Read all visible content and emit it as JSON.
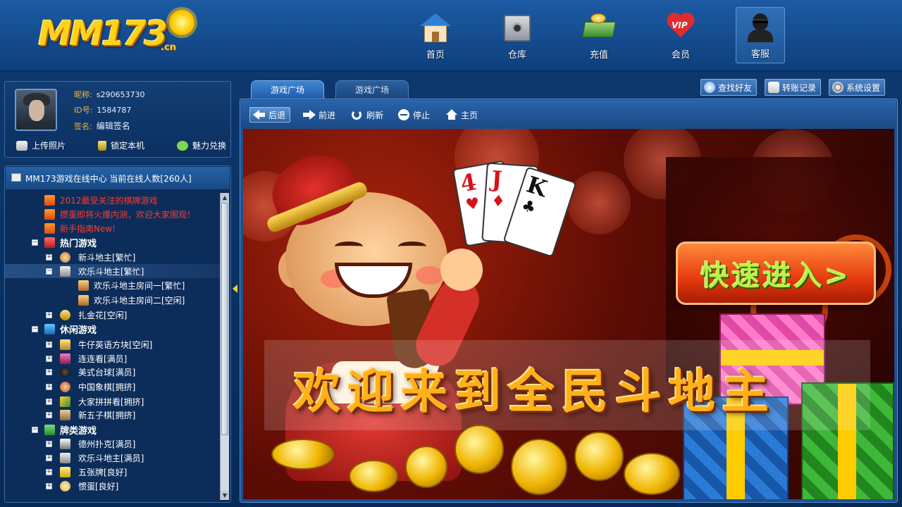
{
  "app": {
    "logo_text": "MM173",
    "logo_sub": ".cn"
  },
  "topnav": [
    {
      "label": "首页",
      "icon": "home-icon"
    },
    {
      "label": "仓库",
      "icon": "safe-icon"
    },
    {
      "label": "充值",
      "icon": "money-icon"
    },
    {
      "label": "会员",
      "icon": "vip-heart-icon",
      "badge": "VIP"
    },
    {
      "label": "客服",
      "icon": "customer-service-icon"
    }
  ],
  "profile": {
    "nick_key": "昵称:",
    "nick": "s290653730",
    "id_key": "ID号:",
    "id": "1584787",
    "sign_key": "签名:",
    "sign": "编辑签名",
    "actions": {
      "upload_photo": "上传照片",
      "lock_machine": "锁定本机",
      "charm_exchange": "魅力兑换"
    }
  },
  "gamelist": {
    "title": "MM173游戏在线中心 当前在线人数[260人]",
    "notices": [
      "2012最受关注的棋牌游戏",
      "掼蛋即将火爆内测，欢迎大家围观！",
      "新手指南New!"
    ],
    "categories": [
      {
        "name": "热门游戏",
        "items": [
          {
            "label": "新斗地主[繁忙]"
          },
          {
            "label": "欢乐斗地主[繁忙]",
            "rooms": [
              "欢乐斗地主房间一[繁忙]",
              "欢乐斗地主房间二[空闲]"
            ]
          },
          {
            "label": "扎金花[空闲]"
          }
        ]
      },
      {
        "name": "休闲游戏",
        "items": [
          {
            "label": "牛仔英语方块[空闲]"
          },
          {
            "label": "连连看[满员]"
          },
          {
            "label": "美式台球[满员]"
          },
          {
            "label": "中国象棋[拥挤]"
          },
          {
            "label": "大家拼拼看[拥挤]"
          },
          {
            "label": "新五子棋[拥挤]"
          }
        ]
      },
      {
        "name": "牌类游戏",
        "items": [
          {
            "label": "德州扑克[满员]"
          },
          {
            "label": "欢乐斗地主[满员]"
          },
          {
            "label": "五张牌[良好]"
          },
          {
            "label": "惯蛋[良好]"
          }
        ]
      }
    ]
  },
  "tabs": [
    "游戏广场",
    "游戏广场"
  ],
  "top_buttons": {
    "find_friend": "查找好友",
    "transfer_record": "转账记录",
    "system_settings": "系统设置"
  },
  "browser_toolbar": {
    "back": "后退",
    "forward": "前进",
    "refresh": "刷新",
    "stop": "停止",
    "home": "主页"
  },
  "banner": {
    "card_values": [
      "4",
      "J",
      "K"
    ],
    "quick_enter": "快速进入>",
    "welcome": "欢迎来到全民斗地主"
  },
  "colors": {
    "header_blue": "#1c5aa3",
    "panel_blue": "#0c2d5a",
    "notice_red": "#ff3b2e",
    "label_orange": "#f5b63a",
    "welcome_gold": "#ffb11a",
    "quick_enter_green": "#b7f24a"
  }
}
